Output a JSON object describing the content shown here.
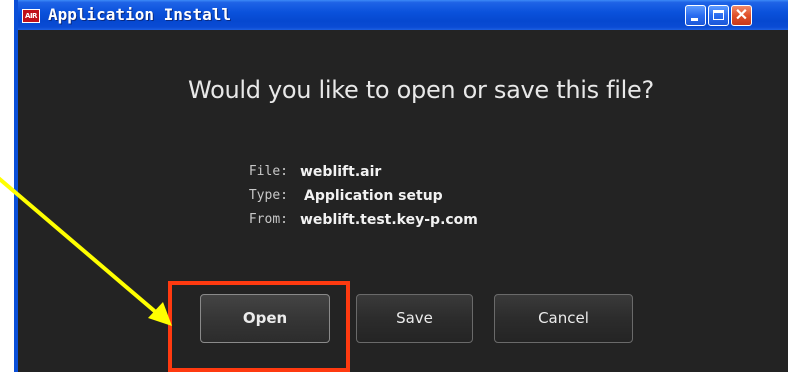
{
  "window": {
    "app_badge": "AIR",
    "title": "Application Install",
    "controls": {
      "minimize": "minimize",
      "maximize": "maximize",
      "close": "✕"
    }
  },
  "dialog": {
    "question": "Would you like to open or save this file?",
    "info": [
      {
        "label": "File:",
        "value": "weblift.air"
      },
      {
        "label": "Type:",
        "value": "Application setup"
      },
      {
        "label": "From:",
        "value": "weblift.test.key-p.com"
      }
    ],
    "buttons": {
      "open": "Open",
      "save": "Save",
      "cancel": "Cancel"
    }
  },
  "annotation": {
    "arrow_color": "#ffff00",
    "box_color": "#ff3a10"
  },
  "colors": {
    "titlebar": "#0a52dc",
    "dialog_bg": "#232323",
    "text": "#e8e8e8"
  }
}
